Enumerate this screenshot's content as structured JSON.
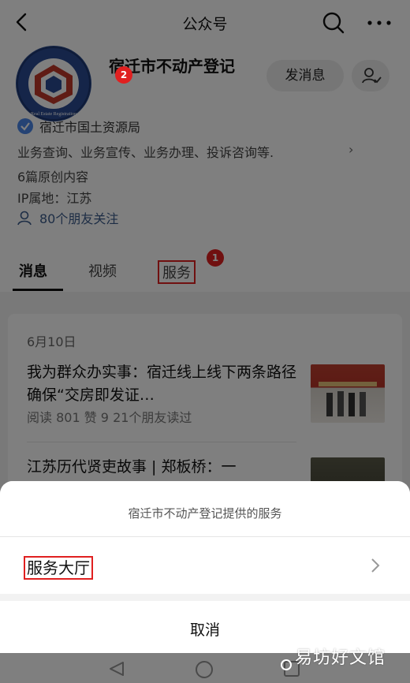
{
  "header": {
    "title": "公众号"
  },
  "profile": {
    "name": "宿迁市不动产登记",
    "send_message_label": "发消息",
    "verified_org": "宿迁市国土资源局",
    "description": "业务查询、业务宣传、业务办理、投诉咨询等.",
    "original_count": "6篇原创内容",
    "ip_location": "IP属地：江苏",
    "friends_following": "80个朋友关注",
    "logo_text": "Real Estate Registration"
  },
  "tabs": [
    {
      "label": "消息"
    },
    {
      "label": "视频"
    },
    {
      "label": "服务"
    }
  ],
  "annotations": {
    "badge_1": "1",
    "badge_2": "2",
    "highlight_color": "#e02020"
  },
  "feed": {
    "date": "6月10日",
    "articles": [
      {
        "title": "我为群众办实事：宿迁线上线下两条路径确保“交房即发证…",
        "meta": "阅读 801   赞 9   21个朋友读过"
      },
      {
        "title": "江苏历代贤吏故事 | 郑板桥：一"
      }
    ]
  },
  "sheet": {
    "title": "宿迁市不动产登记提供的服务",
    "service_item": "服务大厅",
    "cancel_label": "取消"
  },
  "watermark": "易坊好文馆"
}
